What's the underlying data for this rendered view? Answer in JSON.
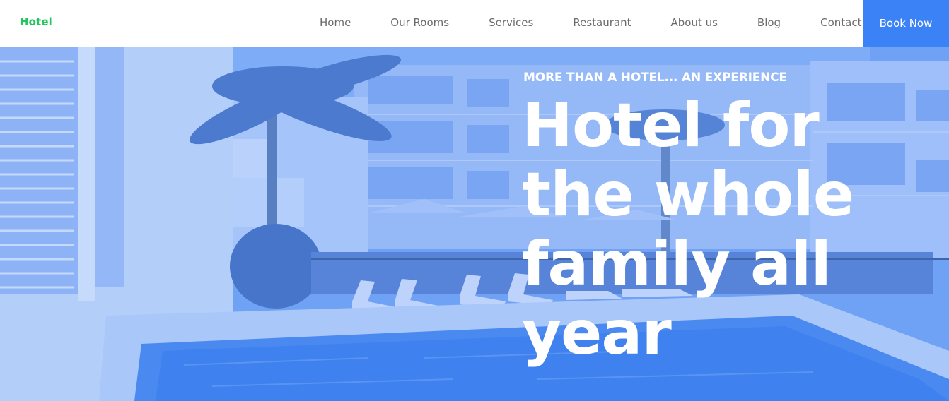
{
  "header": {
    "logo": "Hotel",
    "nav": [
      "Home",
      "Our Rooms",
      "Services",
      "Restaurant",
      "About us",
      "Blog",
      "Contact"
    ],
    "cta": "Book Now"
  },
  "hero": {
    "tagline": "MORE THAN A HOTEL... AN EXPERIENCE",
    "headline": "Hotel for the whole family all year",
    "background_image": "hotel-pool-photo",
    "overlay_color": "#3b82f6"
  },
  "colors": {
    "brand": "#22c55e",
    "accent": "#3b82f6",
    "nav_text": "#6b6b6b"
  }
}
